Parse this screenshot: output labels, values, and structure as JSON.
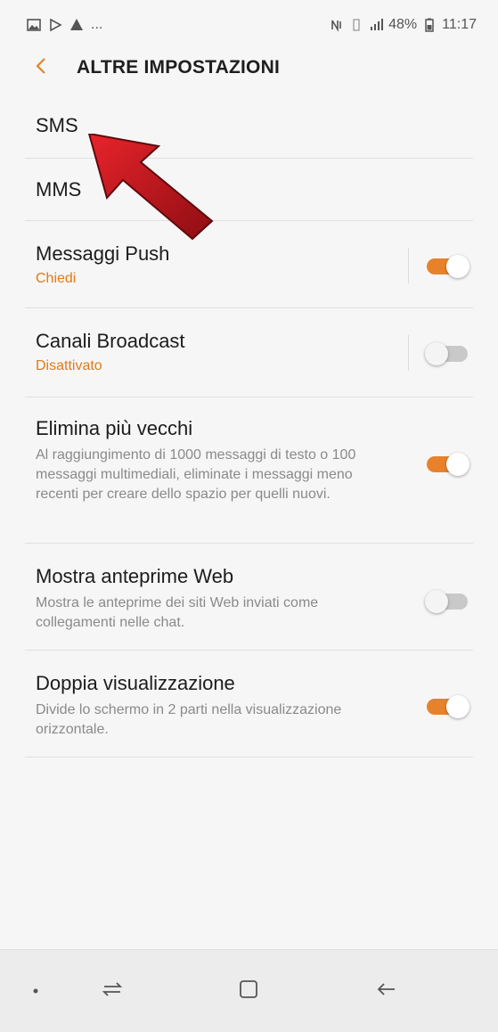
{
  "status_bar": {
    "left_more": "...",
    "battery": "48%",
    "time": "11:17"
  },
  "header": {
    "title": "ALTRE IMPOSTAZIONI",
    "back_icon": "chevron-left-icon"
  },
  "settings": {
    "sms": {
      "title": "SMS"
    },
    "mms": {
      "title": "MMS"
    },
    "push": {
      "title": "Messaggi Push",
      "subtitle": "Chiedi",
      "enabled": true
    },
    "broadcast": {
      "title": "Canali Broadcast",
      "subtitle": "Disattivato",
      "enabled": false
    },
    "delete_old": {
      "title": "Elimina più vecchi",
      "subtitle": "Al raggiungimento di 1000 messaggi di testo o 100 messaggi multimediali, eliminate i messaggi meno recenti per creare dello spazio per quelli nuovi.",
      "enabled": true
    },
    "web_preview": {
      "title": "Mostra anteprime Web",
      "subtitle": "Mostra le anteprime dei siti Web inviati come collegamenti nelle chat.",
      "enabled": false
    },
    "dual_view": {
      "title": "Doppia visualizzazione",
      "subtitle": "Divide lo schermo in 2 parti nella visualizzazione orizzontale.",
      "enabled": true
    }
  },
  "colors": {
    "accent": "#e8822a",
    "toggle_off": "#c9c9c9",
    "arrow": "#c8161d"
  },
  "nav_bar": {
    "icons": [
      "dot-icon",
      "recents-icon",
      "home-icon",
      "back-icon"
    ]
  }
}
